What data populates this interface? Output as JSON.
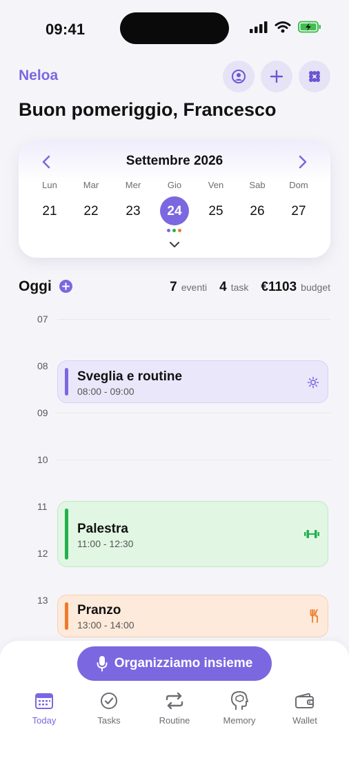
{
  "status_bar": {
    "time": "09:41"
  },
  "header": {
    "brand": "Neloa",
    "greeting": "Buon pomeriggio, Francesco"
  },
  "calendar": {
    "month": "Settembre 2026",
    "weekdays": [
      "Lun",
      "Mar",
      "Mer",
      "Gio",
      "Ven",
      "Sab",
      "Dom"
    ],
    "dates": [
      "21",
      "22",
      "23",
      "24",
      "25",
      "26",
      "27"
    ],
    "selected": "24",
    "dot_colors": [
      "#7b67e0",
      "#22b14c",
      "#f07a2a"
    ]
  },
  "today": {
    "label": "Oggi",
    "events_count": "7",
    "events_label": "eventi",
    "tasks_count": "4",
    "tasks_label": "task",
    "budget_value": "€1103",
    "budget_label": "budget"
  },
  "timeline": {
    "hours": [
      "07",
      "08",
      "09",
      "10",
      "11",
      "12",
      "13"
    ],
    "events": [
      {
        "title": "Sveglia e routine",
        "time": "08:00 - 09:00",
        "icon": "sun-icon",
        "color": "#7b67e0"
      },
      {
        "title": "Palestra",
        "time": "11:00 - 12:30",
        "icon": "dumbbell-icon",
        "color": "#22b14c"
      },
      {
        "title": "Pranzo",
        "time": "13:00 - 14:00",
        "icon": "fork-knife-icon",
        "color": "#f07a2a"
      }
    ]
  },
  "cta": {
    "label": "Organizziamo insieme"
  },
  "tabs": [
    {
      "label": "Today",
      "icon": "calendar-icon",
      "active": true
    },
    {
      "label": "Tasks",
      "icon": "check-circle-icon"
    },
    {
      "label": "Routine",
      "icon": "repeat-icon"
    },
    {
      "label": "Memory",
      "icon": "brain-head-icon"
    },
    {
      "label": "Wallet",
      "icon": "wallet-icon"
    }
  ],
  "colors": {
    "accent": "#7b67e0",
    "background": "#f5f5f9"
  }
}
